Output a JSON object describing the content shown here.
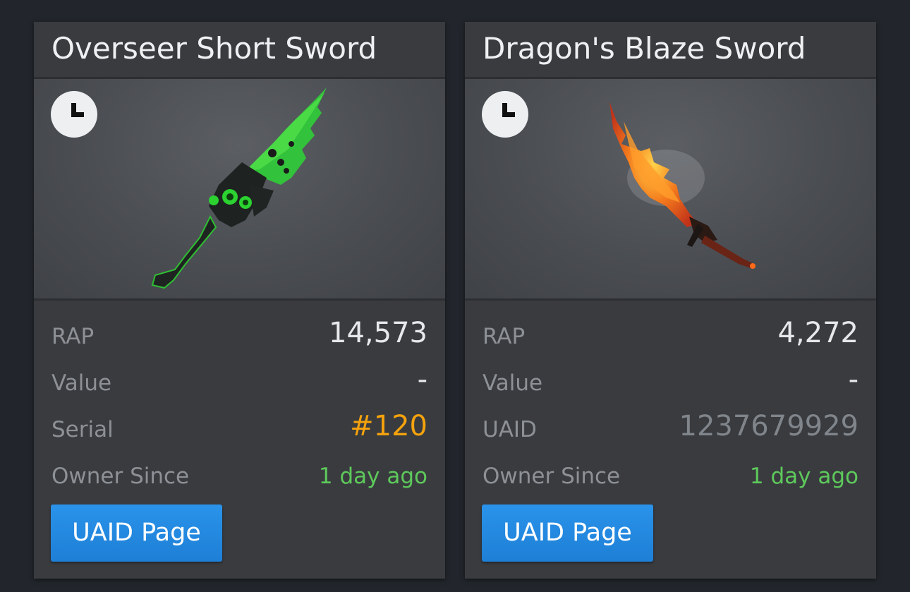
{
  "cards": [
    {
      "title": "Overseer Short Sword",
      "icon": "clock-icon",
      "stats": [
        {
          "label": "RAP",
          "value": "14,573"
        },
        {
          "label": "Value",
          "value": "-"
        },
        {
          "label": "Serial",
          "value": "#120"
        },
        {
          "label": "Owner Since",
          "value": "1 day ago"
        }
      ],
      "button_label": "UAID Page"
    },
    {
      "title": "Dragon's Blaze Sword",
      "icon": "clock-icon",
      "stats": [
        {
          "label": "RAP",
          "value": "4,272"
        },
        {
          "label": "Value",
          "value": "-"
        },
        {
          "label": "UAID",
          "value": "1237679929"
        },
        {
          "label": "Owner Since",
          "value": "1 day ago"
        }
      ],
      "button_label": "UAID Page"
    }
  ],
  "colors": {
    "page_background": "#22262c",
    "card_background": "#393b3f",
    "serial_accent": "#f4a20d",
    "owner_since_green": "#5ec95b",
    "button_blue": "#2a93ea"
  }
}
